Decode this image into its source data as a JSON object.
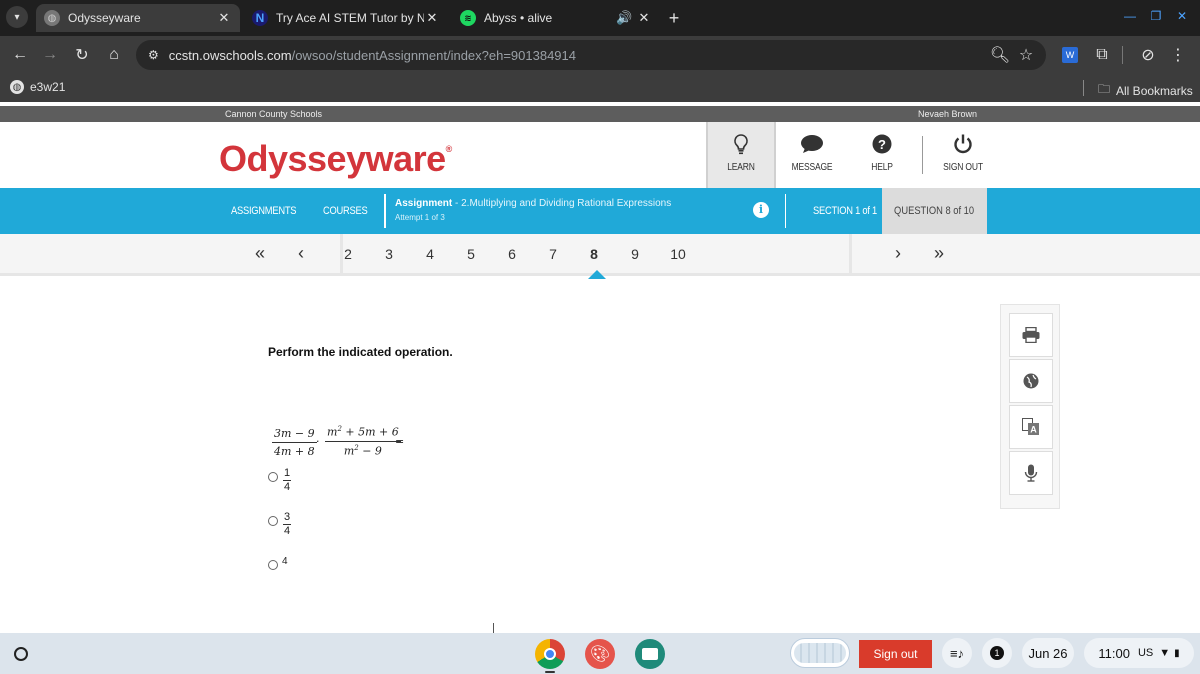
{
  "browser": {
    "tabs": [
      {
        "title": "Odysseyware",
        "active": true
      },
      {
        "title": "Try Ace AI STEM Tutor by Num",
        "active": false
      },
      {
        "title": "Abyss • alive",
        "active": false
      }
    ],
    "url_host": "ccstn.owschools.com",
    "url_path": "/owsoo/studentAssignment/index?eh=901384914",
    "profile_bookmark": "e3w21",
    "all_bookmarks": "All Bookmarks"
  },
  "site": {
    "school": "Cannon County Schools",
    "user": "Nevaeh Brown",
    "logo": "Odysseyware",
    "header_buttons": [
      {
        "label": "LEARN",
        "icon": "lightbulb-icon"
      },
      {
        "label": "MESSAGE",
        "icon": "speech-bubble-icon"
      },
      {
        "label": "HELP",
        "icon": "question-circle-icon"
      },
      {
        "label": "SIGN OUT",
        "icon": "power-icon"
      }
    ],
    "nav": {
      "assignments": "ASSIGNMENTS",
      "courses": "COURSES",
      "assignment_label": "Assignment",
      "assignment_name": "- 2.Multiplying and Dividing Rational Expressions",
      "attempt": "Attempt 1 of 3",
      "section": "SECTION 1 of 1",
      "question": "QUESTION 8 of 10"
    },
    "pages": [
      "2",
      "3",
      "4",
      "5",
      "6",
      "7",
      "8",
      "9",
      "10"
    ],
    "current_page": "8"
  },
  "question": {
    "prompt": "Perform the indicated operation.",
    "expr": {
      "f1_num": "3m − 9",
      "f1_den": "4m + 8",
      "op": "·",
      "f2_num_a": "m",
      "f2_num_b": "2",
      "f2_num_c": " + 5m + 6",
      "f2_den_a": "m",
      "f2_den_b": "2",
      "f2_den_c": " − 9",
      "eq": "="
    },
    "options": [
      {
        "num": "1",
        "den": "4"
      },
      {
        "num": "3",
        "den": "4"
      },
      {
        "value": "4"
      }
    ]
  },
  "shelf": {
    "sign_out": "Sign out",
    "notification_count": "1",
    "date": "Jun 26",
    "time": "11:00",
    "region": "US"
  },
  "colors": {
    "brand_red": "#d3353b",
    "nav_blue": "#20a9d8",
    "sign_out_red": "#d93b2b"
  }
}
